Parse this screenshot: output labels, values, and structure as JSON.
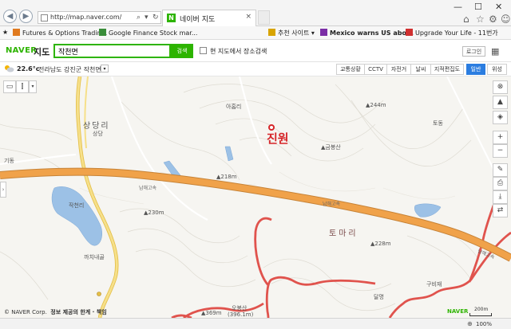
{
  "browser": {
    "url": "http://map.naver.com/",
    "tab_title": "네이버 지도",
    "favorites": [
      {
        "label": "Futures & Options Tradin...",
        "color": "#e07a1f"
      },
      {
        "label": "Google Finance Stock mar...",
        "color": "#3a8d3a"
      },
      {
        "label": "추천 사이트 ▾",
        "color": "#d8a400"
      },
      {
        "label": "Mexico warns US abo...",
        "color": "#7b2ea6"
      },
      {
        "label": "Upgrade Your Life - 11번가",
        "color": "#d03030"
      }
    ],
    "zoom": "100%"
  },
  "naver": {
    "logo_brand": "NAVER",
    "logo_service": "지도",
    "search_value": "작천면",
    "search_button": "검색",
    "area_search_label": "현 지도에서 장소검색",
    "login_label": "로그인",
    "menu_icon": "grid-icon"
  },
  "info_bar": {
    "temperature": "22.6°c",
    "location": "전라남도 강진군 작천면",
    "layers": [
      {
        "label": "교통상황",
        "active": false
      },
      {
        "label": "CCTV",
        "active": false
      },
      {
        "label": "자전거",
        "active": false
      },
      {
        "label": "날씨",
        "active": false
      },
      {
        "label": "지적편집도",
        "active": false
      },
      {
        "label": "일반",
        "active": true
      },
      {
        "label": "위성",
        "active": false
      }
    ]
  },
  "map": {
    "place_name": "진원",
    "village_big": "상당리",
    "village_big2": "토마리",
    "labels": [
      {
        "t": "아홉리"
      },
      {
        "t": "▲244m"
      },
      {
        "t": "토동"
      },
      {
        "t": "▲금봉산"
      },
      {
        "t": "상당"
      },
      {
        "t": "기동"
      },
      {
        "t": "▲218m"
      },
      {
        "t": "작천리"
      },
      {
        "t": "▲230m"
      },
      {
        "t": "까치내골"
      },
      {
        "t": "▲228m"
      },
      {
        "t": "구비재"
      },
      {
        "t": "오봉산"
      },
      {
        "t": "(396.1m)"
      },
      {
        "t": "달명"
      },
      {
        "t": "▲369m"
      }
    ],
    "highway_labels": [
      "남해고속",
      "남해고속",
      "남해고속"
    ],
    "copyright": "© NAVER Corp.",
    "disclaimer": "정보 제공의 한계 · 책임",
    "scale_brand": "NAVER",
    "scale": "200m"
  },
  "colors": {
    "naver_green": "#2db400",
    "highway": "#f0a24a",
    "red_road": "#e0534d",
    "water": "#7aa6d6",
    "active_layer": "#2b7de0"
  }
}
